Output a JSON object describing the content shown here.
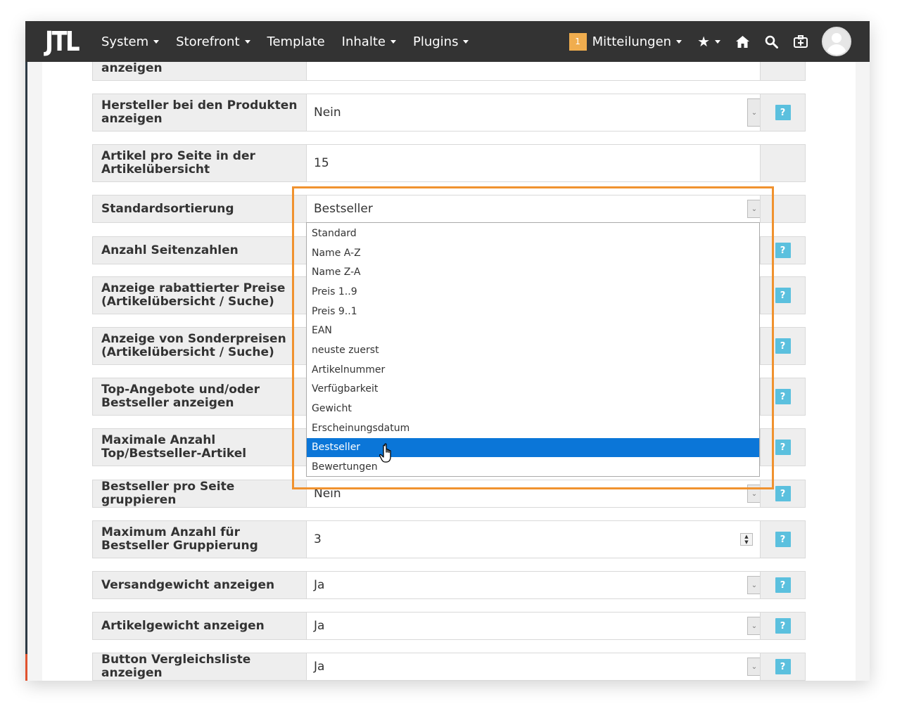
{
  "navbar": {
    "logo": "JTL",
    "menu": [
      {
        "label": "System",
        "dropdown": true
      },
      {
        "label": "Storefront",
        "dropdown": true
      },
      {
        "label": "Template",
        "dropdown": false
      },
      {
        "label": "Inhalte",
        "dropdown": true
      },
      {
        "label": "Plugins",
        "dropdown": true
      }
    ],
    "messages_badge": "1",
    "messages_label": "Mitteilungen",
    "icons": [
      "star-icon",
      "home-icon",
      "search-icon",
      "medkit-icon"
    ]
  },
  "settings": {
    "partial_label": "anzeigen",
    "rows": [
      {
        "label": "Hersteller bei den Produkten anzeigen",
        "value": "Nein",
        "type": "select",
        "help": true
      },
      {
        "label": "Artikel pro Seite in der Artikelübersicht",
        "value": "15",
        "type": "text",
        "help": false
      },
      {
        "label": "Standardsortierung",
        "value": "Bestseller",
        "type": "select",
        "help": false
      },
      {
        "label": "Anzahl Seitenzahlen",
        "value": "",
        "type": "select",
        "help": true
      },
      {
        "label": "Anzeige rabattierter Preise (Artikelübersicht / Suche)",
        "value": "",
        "type": "select",
        "help": true
      },
      {
        "label": "Anzeige von Sonderpreisen (Artikelübersicht / Suche)",
        "value": "",
        "type": "select",
        "help": true
      },
      {
        "label": "Top-Angebote und/oder Bestseller anzeigen",
        "value": "",
        "type": "select",
        "help": true
      },
      {
        "label": "Maximale Anzahl Top/Bestseller-Artikel",
        "value": "",
        "type": "text",
        "help": true
      },
      {
        "label": "Bestseller pro Seite gruppieren",
        "value": "Nein",
        "type": "select",
        "help": true
      },
      {
        "label": "Maximum Anzahl für Bestseller Gruppierung",
        "value": "3",
        "type": "number",
        "help": true
      },
      {
        "label": "Versandgewicht anzeigen",
        "value": "Ja",
        "type": "select",
        "help": true
      },
      {
        "label": "Artikelgewicht anzeigen",
        "value": "Ja",
        "type": "select",
        "help": true
      },
      {
        "label": "Button Vergleichsliste anzeigen",
        "value": "Ja",
        "type": "select",
        "help": true
      }
    ],
    "help_label": "?"
  },
  "dropdown": {
    "options": [
      "Standard",
      "Name A-Z",
      "Name Z-A",
      "Preis 1..9",
      "Preis 9..1",
      "EAN",
      "neuste zuerst",
      "Artikelnummer",
      "Verfügbarkeit",
      "Gewicht",
      "Erscheinungsdatum",
      "Bestseller",
      "Bewertungen"
    ],
    "selected": "Bestseller"
  },
  "colors": {
    "navbar": "#333333",
    "badge": "#f0ad4e",
    "help_button": "#5bc0de",
    "selection": "#0b76d8",
    "highlight": "#f0922f"
  }
}
